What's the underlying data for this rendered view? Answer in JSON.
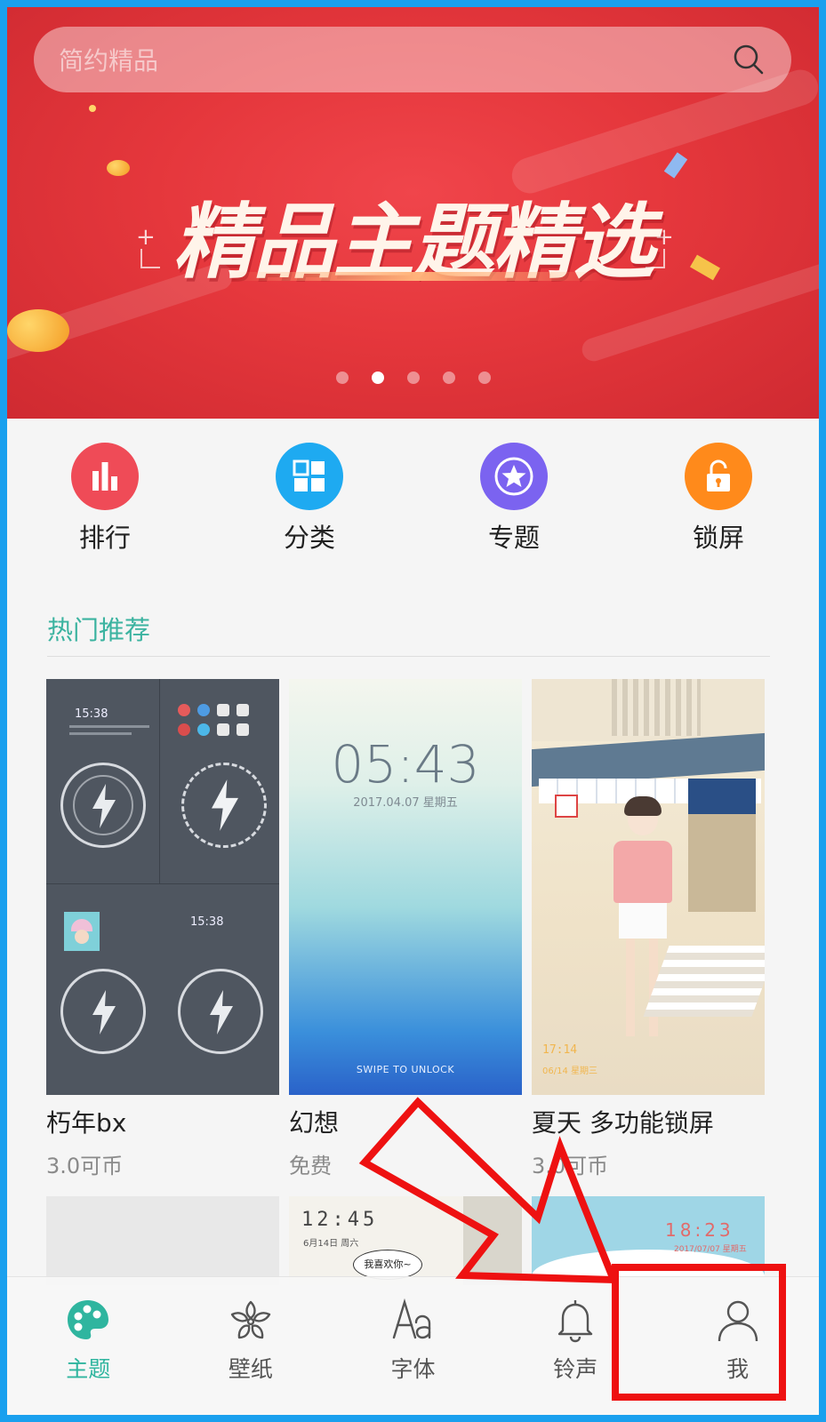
{
  "search": {
    "placeholder": "简约精品"
  },
  "banner": {
    "title": "精品主题精选",
    "pages": 5,
    "active_page": 2
  },
  "shortcuts": [
    {
      "label": "排行",
      "icon": "ranking-icon",
      "color": "#ef4b57"
    },
    {
      "label": "分类",
      "icon": "category-icon",
      "color": "#1eaaf1"
    },
    {
      "label": "专题",
      "icon": "star-icon",
      "color": "#7b63f0"
    },
    {
      "label": "锁屏",
      "icon": "lock-icon",
      "color": "#ff8a1b"
    }
  ],
  "section": {
    "title": "热门推荐"
  },
  "cards": [
    {
      "name": "朽年bx",
      "price": "3.0可币",
      "preview": {
        "time1": "15:38",
        "time2": "15:38"
      }
    },
    {
      "name": "幻想",
      "price": "免费",
      "preview": {
        "time": "05:43",
        "date": "2017.04.07   星期五",
        "swipe": "SWIPE TO UNLOCK"
      }
    },
    {
      "name": "夏天 多功能锁屏",
      "price": "3.0可币",
      "preview": {
        "time": "17:14",
        "date": "06/14 星期三"
      }
    }
  ],
  "row2": [
    {
      "preview": {}
    },
    {
      "preview": {
        "time": "12:45",
        "date": "6月14日  周六",
        "note": "我喜欢你~"
      }
    },
    {
      "preview": {
        "time": "18:23",
        "date": "2017/07/07 星期五"
      }
    }
  ],
  "nav": [
    {
      "label": "主题",
      "icon": "palette-icon",
      "active": true
    },
    {
      "label": "壁纸",
      "icon": "flower-icon",
      "active": false
    },
    {
      "label": "字体",
      "icon": "font-icon",
      "active": false
    },
    {
      "label": "铃声",
      "icon": "bell-icon",
      "active": false
    },
    {
      "label": "我",
      "icon": "person-icon",
      "active": false
    }
  ],
  "colors": {
    "accent": "#2fb59f",
    "annotation": "#ee1111",
    "banner": "#e5373c"
  }
}
